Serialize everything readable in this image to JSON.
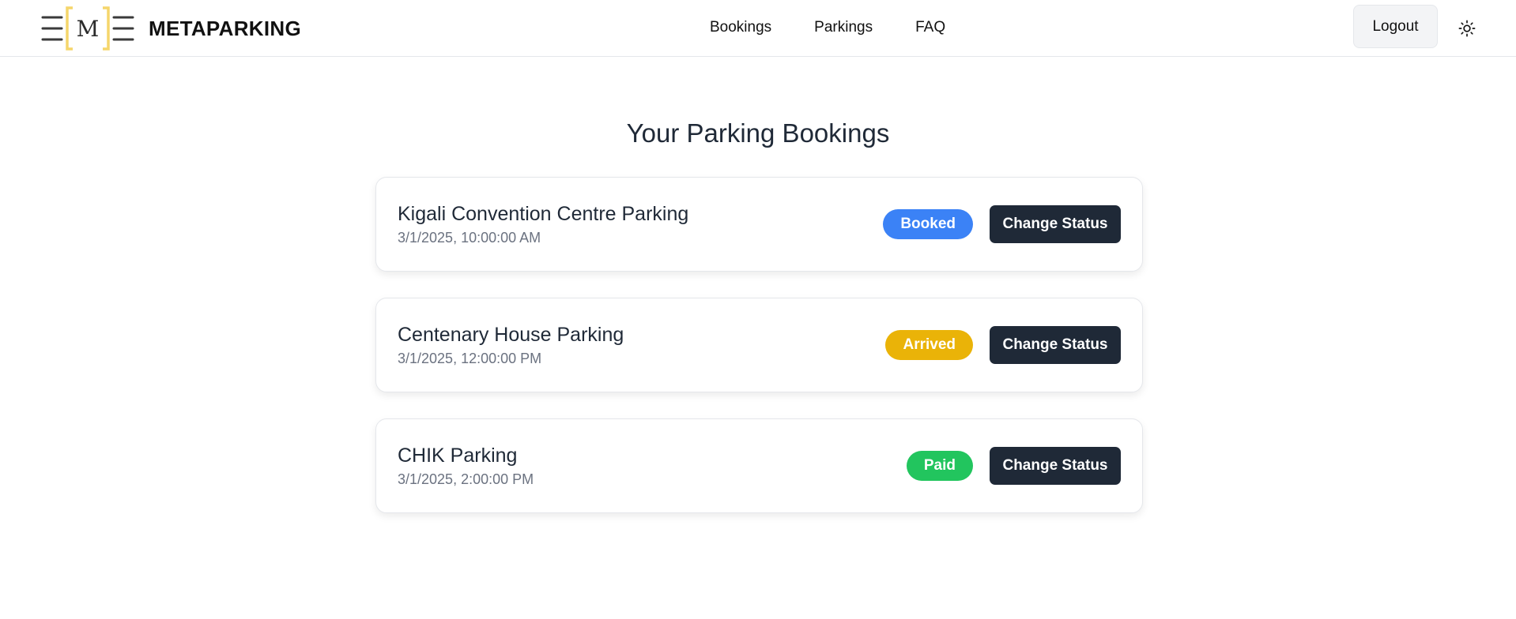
{
  "brand": {
    "logo_letter": "M",
    "name": "METAPARKING"
  },
  "nav": {
    "items": [
      {
        "label": "Bookings"
      },
      {
        "label": "Parkings"
      },
      {
        "label": "FAQ"
      }
    ]
  },
  "header": {
    "logout_label": "Logout",
    "theme_icon": "sun-icon"
  },
  "page": {
    "title": "Your Parking Bookings"
  },
  "bookings": [
    {
      "name": "Kigali Convention Centre Parking",
      "datetime": "3/1/2025, 10:00:00 AM",
      "status": "Booked",
      "status_color": "#3b82f6",
      "action_label": "Change Status"
    },
    {
      "name": "Centenary House Parking",
      "datetime": "3/1/2025, 12:00:00 PM",
      "status": "Arrived",
      "status_color": "#eab308",
      "action_label": "Change Status"
    },
    {
      "name": "CHIK Parking",
      "datetime": "3/1/2025, 2:00:00 PM",
      "status": "Paid",
      "status_color": "#22c55e",
      "action_label": "Change Status"
    }
  ],
  "colors": {
    "logo_bracket": "#f5d66b",
    "button_dark": "#1f2937"
  }
}
